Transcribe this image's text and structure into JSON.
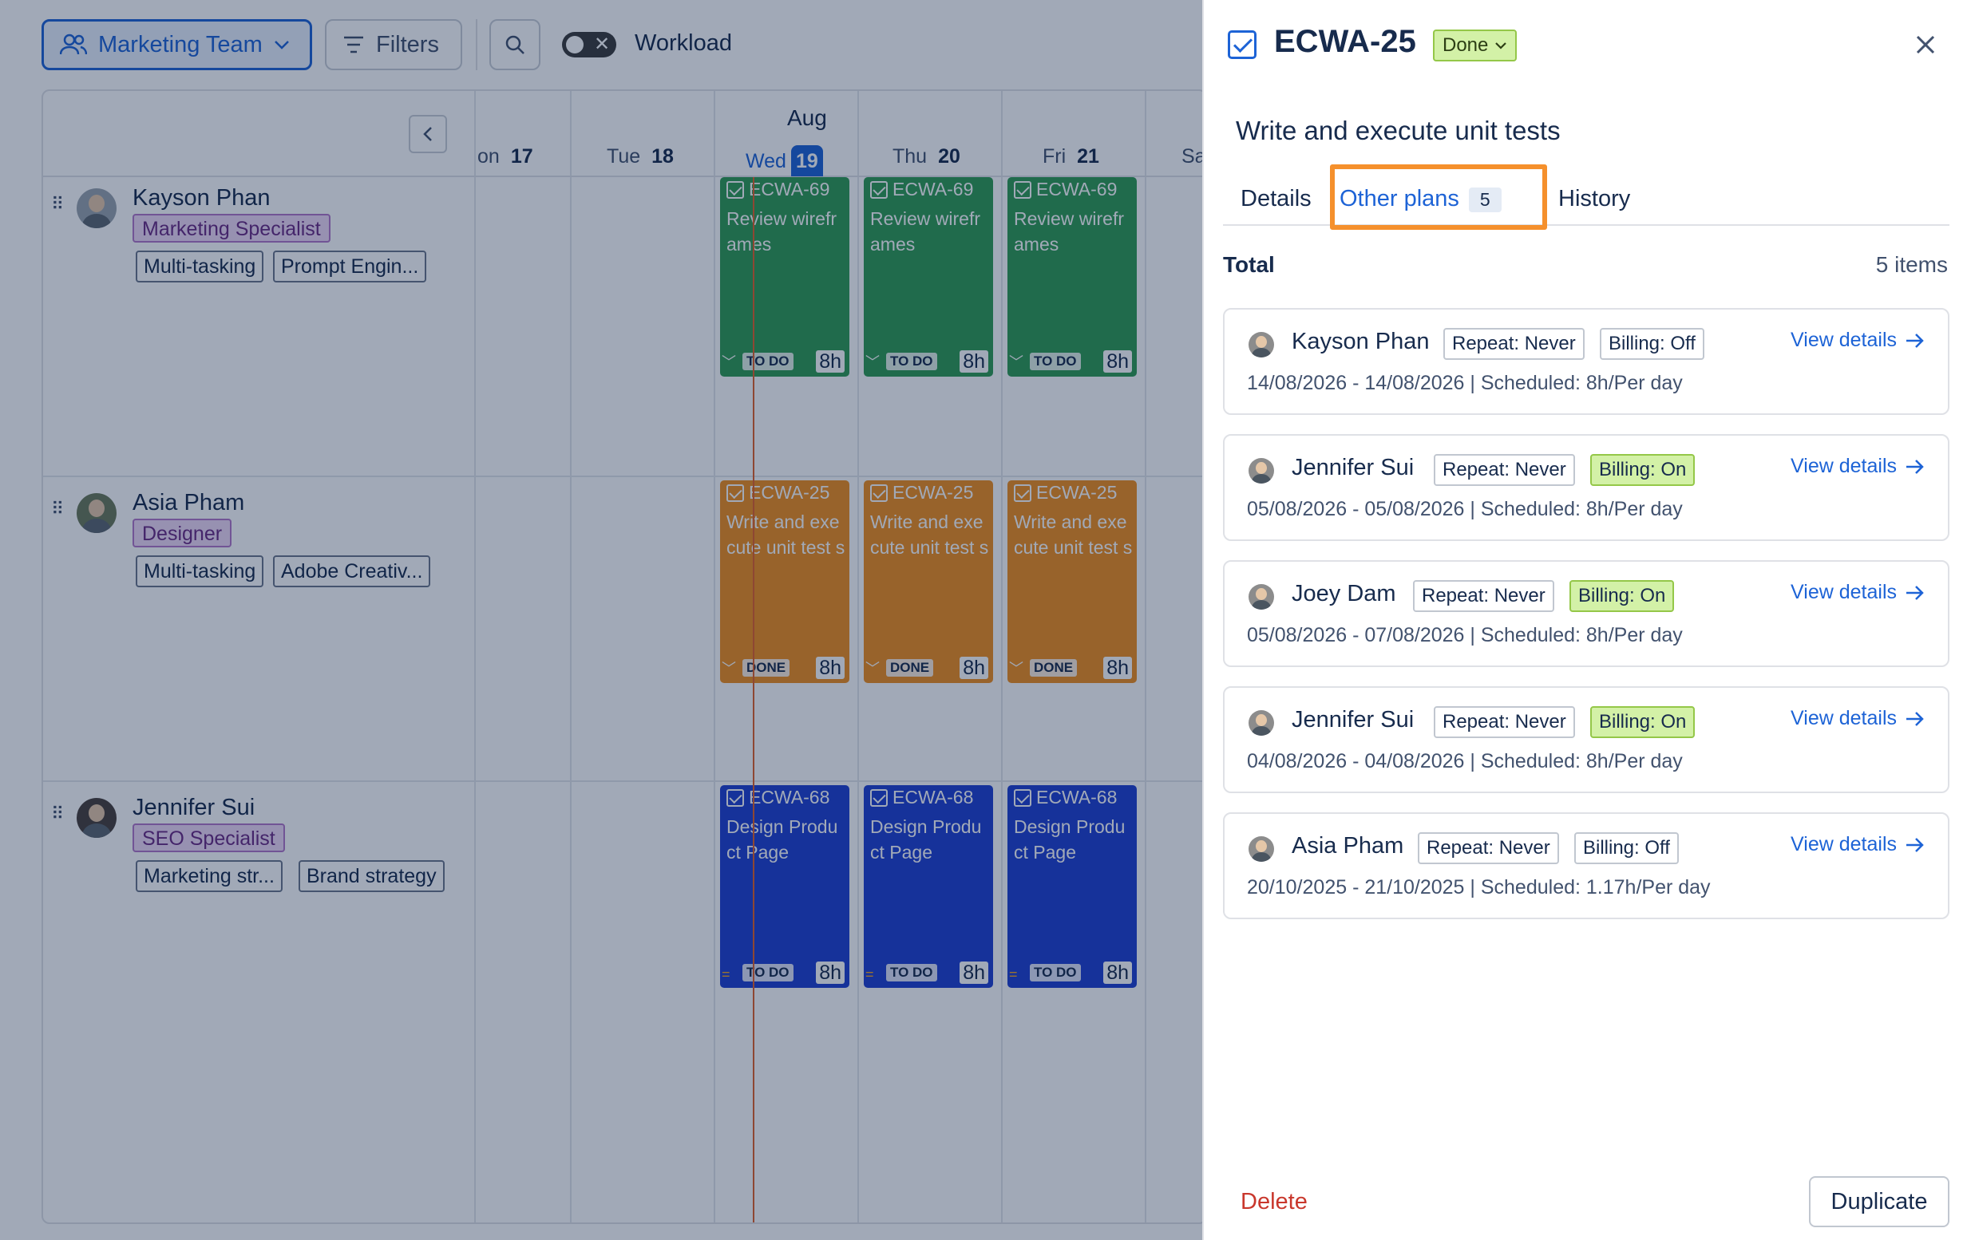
{
  "toolbar": {
    "team_label": "Marketing Team",
    "filters_label": "Filters",
    "workload_label": "Workload"
  },
  "timeline": {
    "month": "Aug",
    "days": [
      {
        "dow": "on",
        "num": "17"
      },
      {
        "dow": "Tue",
        "num": "18"
      },
      {
        "dow": "Wed",
        "num": "19"
      },
      {
        "dow": "Thu",
        "num": "20"
      },
      {
        "dow": "Fri",
        "num": "21"
      },
      {
        "dow": "Sa",
        "num": ""
      }
    ]
  },
  "people": [
    {
      "name": "Kayson Phan",
      "role": "Marketing Specialist",
      "skills": [
        "Multi-tasking",
        "Prompt Engin..."
      ],
      "task": {
        "key": "ECWA-69",
        "title": "Review wirefr ames",
        "status": "TO DO",
        "hours": "8h",
        "color": "#2f9b53"
      }
    },
    {
      "name": "Asia Pham",
      "role": "Designer",
      "skills": [
        "Multi-tasking",
        "Adobe Creativ..."
      ],
      "task": {
        "key": "ECWA-25",
        "title": "Write and exe cute unit test s",
        "status": "DONE",
        "hours": "8h",
        "color": "#f18f1d"
      }
    },
    {
      "name": "Jennifer Sui",
      "role": "SEO Specialist",
      "skills": [
        "Marketing str...",
        "Brand strategy"
      ],
      "task": {
        "key": "ECWA-68",
        "title": "Design Produ ct Page",
        "status": "TO DO",
        "hours": "8h",
        "color": "#1f3fd1"
      }
    }
  ],
  "panel": {
    "issue_key": "ECWA-25",
    "status": "Done",
    "title": "Write and execute unit tests",
    "tabs": {
      "details": "Details",
      "other_plans": "Other plans",
      "other_plans_count": "5",
      "history": "History"
    },
    "total_label": "Total",
    "total_count": "5 items",
    "plans": [
      {
        "name": "Kayson Phan",
        "repeat": "Repeat: Never",
        "billing": "Billing: Off",
        "billing_on": false,
        "dates": "14/08/2026 - 14/08/2026 | Scheduled: 8h/Per day",
        "link": "View details"
      },
      {
        "name": "Jennifer Sui",
        "repeat": "Repeat: Never",
        "billing": "Billing: On",
        "billing_on": true,
        "dates": "05/08/2026 - 05/08/2026 | Scheduled: 8h/Per day",
        "link": "View details"
      },
      {
        "name": "Joey Dam",
        "repeat": "Repeat: Never",
        "billing": "Billing: On",
        "billing_on": true,
        "dates": "05/08/2026 - 07/08/2026 | Scheduled: 8h/Per day",
        "link": "View details"
      },
      {
        "name": "Jennifer Sui",
        "repeat": "Repeat: Never",
        "billing": "Billing: On",
        "billing_on": true,
        "dates": "04/08/2026 - 04/08/2026 | Scheduled: 8h/Per day",
        "link": "View details"
      },
      {
        "name": "Asia Pham",
        "repeat": "Repeat: Never",
        "billing": "Billing: Off",
        "billing_on": false,
        "dates": "20/10/2025 - 21/10/2025 | Scheduled: 1.17h/Per day",
        "link": "View details"
      }
    ],
    "delete_label": "Delete",
    "duplicate_label": "Duplicate"
  }
}
